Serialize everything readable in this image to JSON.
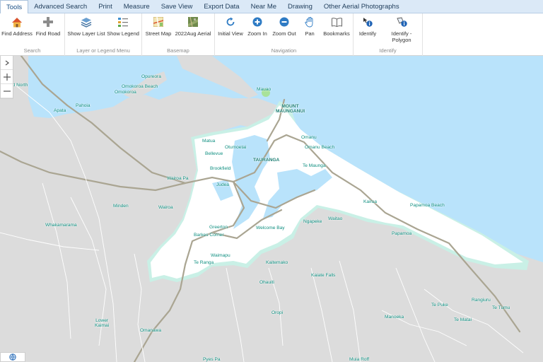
{
  "tabs": [
    "Tools",
    "Advanced Search",
    "Print",
    "Measure",
    "Save View",
    "Export Data",
    "Near Me",
    "Drawing",
    "Other Aerial Photographs"
  ],
  "ribbon": {
    "search": {
      "label": "Search",
      "find_address": "Find Address",
      "find_road": "Find Road"
    },
    "layers": {
      "label": "Layer or Legend Menu",
      "show_layer_list": "Show Layer List",
      "show_legend": "Show Legend"
    },
    "basemap": {
      "label": "Basemap",
      "street_map": "Street Map",
      "aerial": "2022Aug Aerial"
    },
    "navigation": {
      "label": "Navigation",
      "initial_view": "Initial View",
      "zoom_in": "Zoom In",
      "zoom_out": "Zoom Out",
      "pan": "Pan",
      "bookmarks": "Bookmarks"
    },
    "identify": {
      "label": "Identify",
      "identify": "Identify",
      "identify_polygon_1": "Identify -",
      "identify_polygon_2": "Polygon"
    }
  },
  "map": {
    "colors": {
      "sea": "#b9e3fb",
      "land": "#dcdcdc",
      "urban": "#ffffff",
      "fringe": "#c9f0e6",
      "road": "#aaa592",
      "label": "#0f8f80"
    },
    "places": {
      "opureora": "Opureora",
      "omokoroa_beach": "Omokoroa Beach",
      "omokoroa": "Omokoroa",
      "te_puna_north": "nd North",
      "pahoia": "Pahoia",
      "apata": "Apata",
      "matua": "Matua",
      "otumoetai": "Otumoetai",
      "bellevue": "Bellevue",
      "brookfield": "Brookfield",
      "tauranga": "TAURANGA",
      "mauao": "Mauao",
      "mount_maunganui_1": "MOUNT",
      "mount_maunganui_2": "MAUNGANUI",
      "omanu": "Omanu",
      "omanu_beach": "Omanu Beach",
      "te_maunga": "Te Maunga",
      "wairoa_pa": "Wairoa Pa",
      "judea": "Judea",
      "minden": "Minden",
      "wairoa": "Wairoa",
      "kairua": "Kairua",
      "papamoa_beach": "Papamoa Beach",
      "whakamarama": "Whakamarama",
      "greerton": "Greerton",
      "welcome_bay": "Welcome Bay",
      "ngapeke": "Ngapeke",
      "waitao": "Waitao",
      "papamoa": "Papamoa",
      "barkes_corner": "Barkes Corner",
      "waimapu": "Waimapu",
      "te_ranga": "Te Ranga",
      "kaitemako": "Kaitemako",
      "kaiate_falls": "Kaiate Falls",
      "ohauiti": "Ohauiti",
      "te_puke": "Te Puke",
      "rangiuru": "Rangiuru",
      "te_tumu": "Te Tumu",
      "lower_kaimai_1": "Lower",
      "lower_kaimai_2": "Kaimai",
      "oropi": "Oropi",
      "manoeka": "Manoeka",
      "te_matai": "Te Matai",
      "omanawa": "Omanawa",
      "pyes_pa": "Pyes Pa",
      "muia_roff": "Muia Roff"
    }
  }
}
